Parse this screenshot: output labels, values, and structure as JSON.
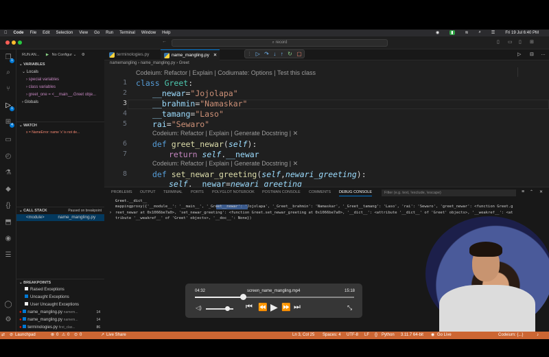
{
  "menubar": {
    "app": "Code",
    "items": [
      "File",
      "Edit",
      "Selection",
      "View",
      "Go",
      "Run",
      "Terminal",
      "Window",
      "Help"
    ],
    "clock": "Fri 19 Jul  6:40 PM"
  },
  "command_center": {
    "label": "record"
  },
  "activity_badges": {
    "explorer": "1",
    "debug": "1",
    "extensions": "4"
  },
  "sidebar": {
    "run_label": "RUN AN...",
    "config": "No Configur",
    "variables_title": "VARIABLES",
    "locals": "Locals",
    "special_vars": "special variables",
    "class_vars": "class variables",
    "greet_one": "greet_one = <__main__.Greet obje...",
    "globals": "Globals",
    "watch_title": "WATCH",
    "watch_item": "x = NameError: name 'x' is not de...",
    "callstack_title": "CALL STACK",
    "callstack_status": "Paused on breakpoint",
    "frame_module": "<module>",
    "frame_file": "name_mangling.py",
    "breakpoints_title": "BREAKPOINTS",
    "bp_raised": "Raised Exceptions",
    "bp_uncaught": "Uncaught Exceptions",
    "bp_user": "User Uncaught Exceptions",
    "bp_items": [
      {
        "file": "name_mangling.py",
        "dir": "namem...",
        "line": "14"
      },
      {
        "file": "name_mangling.py",
        "dir": "namem...",
        "line": "14"
      },
      {
        "file": "terminologies.py",
        "dir": "first_clas...",
        "line": "86"
      }
    ]
  },
  "tabs": [
    {
      "label": "terminologies.py"
    },
    {
      "label": "name_mangling.py"
    }
  ],
  "breadcrumb": {
    "folder": "namemangling",
    "file": "name_mangling.py",
    "symbol": "Greet"
  },
  "codelens": {
    "class": "Codeium: Refactor | Explain | Codiumate: Options | Test this class",
    "fn": "Codeium: Refactor | Explain | Generate Docstring | ✕"
  },
  "code_lines": [
    {
      "n": "1",
      "text": "class Greet:"
    },
    {
      "n": "2",
      "text": "__newar=\"Jojolapa\""
    },
    {
      "n": "3",
      "text": "__brahmin=\"Namaskar\""
    },
    {
      "n": "4",
      "text": "__tamang=\"Laso\""
    },
    {
      "n": "5",
      "text": "rai=\"Sewaro\""
    },
    {
      "n": "6",
      "text": "def greet_newar(self):"
    },
    {
      "n": "7",
      "text": "return self.__newar"
    },
    {
      "n": "8",
      "text": "def set_newar_greeting(self,newari_greeting):"
    },
    {
      "n": "9",
      "text": "self.__newar=newari_greeting"
    }
  ],
  "panel": {
    "tabs": [
      "PROBLEMS",
      "OUTPUT",
      "TERMINAL",
      "PORTS",
      "POLYGLOT NOTEBOOK",
      "POSTMAN CONSOLE",
      "COMMENTS",
      "DEBUG CONSOLE"
    ],
    "filter_placeholder": "Filter (e.g. text, !exclude, \\escape)",
    "input": "Greet.__dict__",
    "output_1": "mappingproxy({'__module__': '__main__', '_Greet__newar': 'Jojolapa', '_Greet__brahmin': 'Namaskar', '_Greet__tamang': 'Laso', 'rai': 'Sewaro', 'greet_newar': <function Greet.g",
    "output_2": "reet_newar at 0x1066be7a0>, 'set_newar_greeting': <function Greet.set_newar_greeting at 0x1066be7a0>, '__dict__': <attribute '__dict__' of 'Greet' objects>, '__weakref__': <at",
    "output_3": "tribute '__weakref__' of 'Greet' objects>, '__doc__': None})"
  },
  "video": {
    "elapsed": "04:32",
    "title": "screen_name_mangling.mp4",
    "total": "15:18",
    "progress": 0.3
  },
  "statusbar": {
    "launchpad": "Launchpad",
    "errors": "0",
    "warnings": "0",
    "ports": "0",
    "live_share": "Live Share",
    "position": "Ln 3, Col 25",
    "spaces": "Spaces: 4",
    "encoding": "UTF-8",
    "eol": "LF",
    "language": "Python",
    "interpreter": "3.11.7 64-bit",
    "golive": "Go Live",
    "codeium": "Codeium: {...}"
  }
}
